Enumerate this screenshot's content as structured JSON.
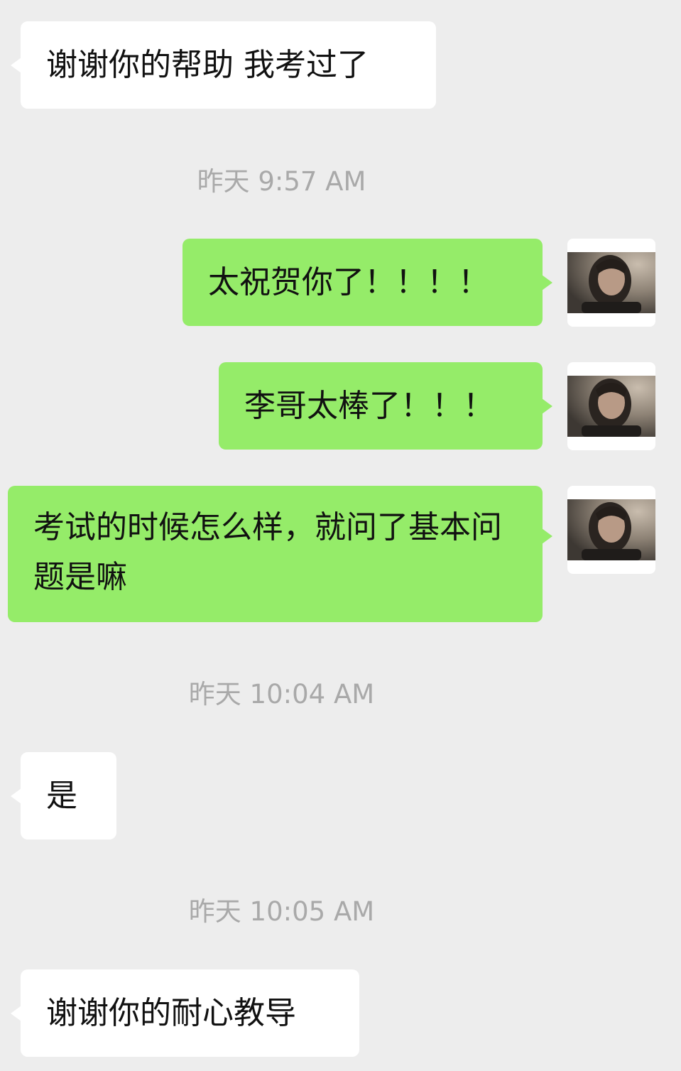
{
  "messages": [
    {
      "type": "incoming",
      "text": "谢谢你的帮助 我考过了"
    },
    {
      "type": "timestamp",
      "text": "昨天 9:57 AM"
    },
    {
      "type": "outgoing",
      "text": "太祝贺你了！！！！"
    },
    {
      "type": "outgoing",
      "text": "李哥太棒了！！！"
    },
    {
      "type": "outgoing",
      "text": "考试的时候怎么样，就问了基本问题是嘛"
    },
    {
      "type": "timestamp",
      "text": "昨天 10:04 AM"
    },
    {
      "type": "incoming",
      "text": "是"
    },
    {
      "type": "timestamp",
      "text": "昨天 10:05 AM"
    },
    {
      "type": "incoming",
      "text": "谢谢你的耐心教导"
    }
  ],
  "colors": {
    "background": "#ededed",
    "incoming_bubble": "#ffffff",
    "outgoing_bubble": "#95ec69",
    "timestamp_text": "#a9a9a9",
    "message_text": "#111111"
  },
  "icons": {
    "avatar": "user-avatar-photo"
  }
}
